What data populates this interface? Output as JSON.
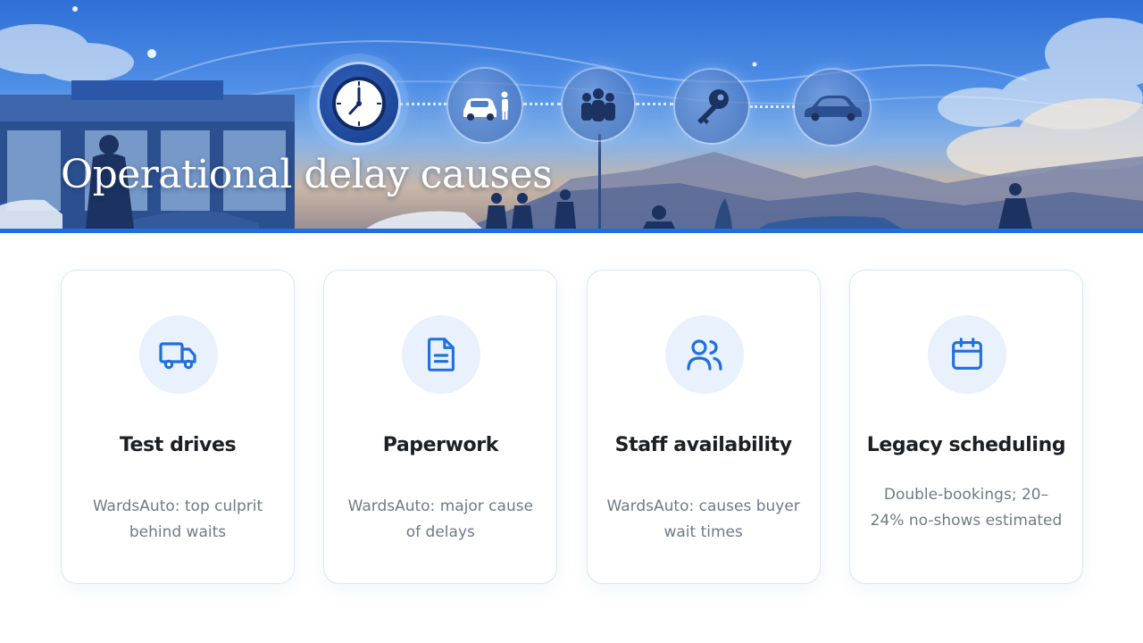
{
  "header": {
    "title": "Operational delay causes",
    "journey_icons": [
      "clock-icon",
      "car-person-icon",
      "people-icon",
      "key-icon",
      "car-icon"
    ]
  },
  "cards": [
    {
      "icon": "truck-icon",
      "title": "Test drives",
      "description": "WardsAuto: top culprit behind waits"
    },
    {
      "icon": "document-icon",
      "title": "Paperwork",
      "description": "WardsAuto: major cause of delays"
    },
    {
      "icon": "users-icon",
      "title": "Staff availability",
      "description": "WardsAuto: causes buyer wait times"
    },
    {
      "icon": "calendar-icon",
      "title": "Legacy scheduling",
      "description": "Double-bookings; 20–24% no-shows estimated"
    }
  ],
  "colors": {
    "accent": "#1f6fe0",
    "icon_stroke": "#1f6fe0",
    "icon_bg": "#e8f1fc",
    "card_border": "#d7e7f7",
    "title_text": "#1c1f24",
    "body_text": "#6f7a86"
  }
}
